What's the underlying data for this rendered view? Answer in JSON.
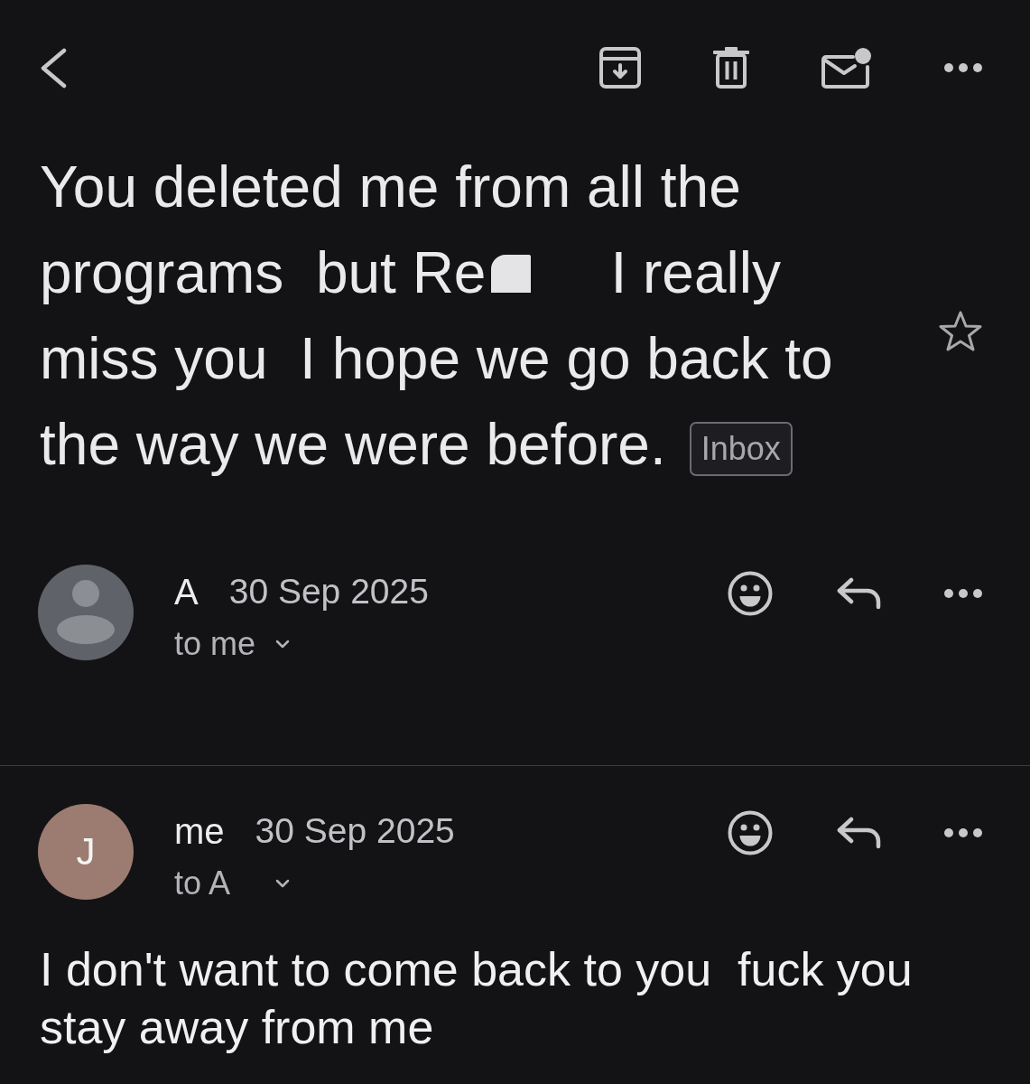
{
  "subject": {
    "lines": [
      {
        "parts": [
          {
            "kind": "text",
            "text": "You deleted me from all the"
          }
        ]
      },
      {
        "parts": [
          {
            "kind": "text",
            "text": "programs  but Re"
          },
          {
            "kind": "redaction"
          },
          {
            "kind": "text",
            "text": "I really"
          }
        ]
      },
      {
        "parts": [
          {
            "kind": "text",
            "text": "miss you  I hope we go back to"
          }
        ]
      },
      {
        "parts": [
          {
            "kind": "text",
            "text": "the way we were before."
          }
        ]
      }
    ],
    "label": "Inbox",
    "starred": false
  },
  "messages": [
    {
      "sender": "A",
      "date": "30 Sep 2025",
      "recipients": "to me",
      "avatar": {
        "kind": "silhouette",
        "color": "#5f6268"
      }
    },
    {
      "sender": "me",
      "date": "30 Sep 2025",
      "recipients": "to A",
      "avatar": {
        "kind": "initial",
        "initial": "J",
        "color": "#9c7b71"
      },
      "body": "I don't want to come back to you  fuck you stay away from me"
    }
  ]
}
